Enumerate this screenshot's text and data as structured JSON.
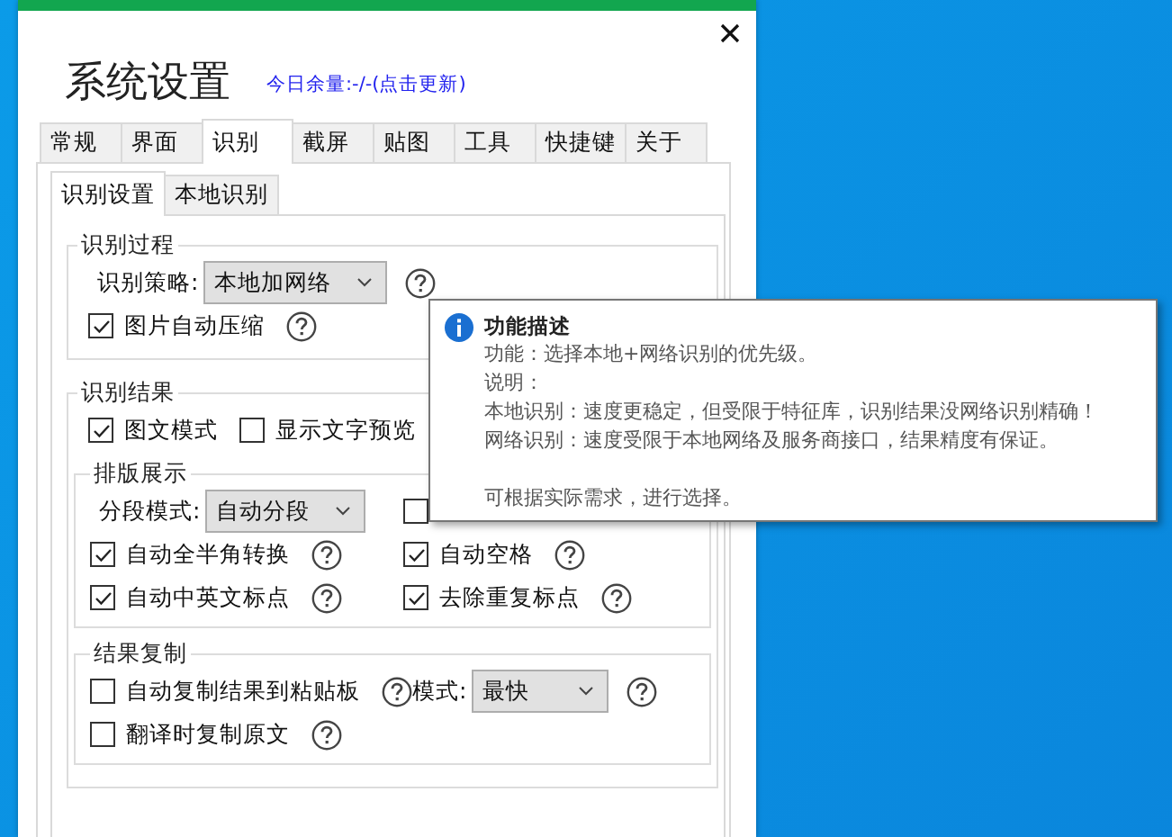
{
  "window": {
    "title": "系统设置",
    "quota_link": "今日余量:-/-(点击更新)"
  },
  "tabs": [
    {
      "label": "常规",
      "selected": false
    },
    {
      "label": "界面",
      "selected": false
    },
    {
      "label": "识别",
      "selected": true
    },
    {
      "label": "截屏",
      "selected": false
    },
    {
      "label": "贴图",
      "selected": false
    },
    {
      "label": "工具",
      "selected": false
    },
    {
      "label": "快捷键",
      "selected": false
    },
    {
      "label": "关于",
      "selected": false
    }
  ],
  "subtabs": [
    {
      "label": "识别设置",
      "selected": true
    },
    {
      "label": "本地识别",
      "selected": false
    }
  ],
  "groups": [
    {
      "title": "识别过程",
      "rows": [
        {
          "columns": [
            [
              {
                "kind": "select",
                "label": "识别策略:",
                "value": "本地加网络"
              },
              {
                "kind": "help"
              }
            ]
          ]
        },
        {
          "columns": [
            [
              {
                "kind": "checkbox",
                "label": "图片自动压缩",
                "checked": true
              },
              {
                "kind": "help"
              }
            ]
          ]
        }
      ]
    },
    {
      "title": "识别结果",
      "rows": [
        {
          "columns": [
            [
              {
                "kind": "checkbox",
                "label": "图文模式",
                "checked": true
              },
              {
                "kind": "checkbox",
                "label": "显示文字预览",
                "checked": false
              }
            ]
          ]
        }
      ],
      "children": [
        {
          "title": "排版展示",
          "rows": [
            {
              "columns": [
                [
                  {
                    "kind": "select",
                    "label": "分段模式:",
                    "value": "自动分段"
                  }
                ],
                [
                  {
                    "kind": "checkbox",
                    "checked": false
                  }
                ]
              ]
            },
            {
              "columns": [
                [
                  {
                    "kind": "checkbox",
                    "label": "自动全半角转换",
                    "checked": true
                  },
                  {
                    "kind": "help"
                  }
                ],
                [
                  {
                    "kind": "checkbox",
                    "label": "自动空格",
                    "checked": true
                  },
                  {
                    "kind": "help"
                  }
                ]
              ]
            },
            {
              "columns": [
                [
                  {
                    "kind": "checkbox",
                    "label": "自动中英文标点",
                    "checked": true
                  },
                  {
                    "kind": "help"
                  }
                ],
                [
                  {
                    "kind": "checkbox",
                    "label": "去除重复标点",
                    "checked": true
                  },
                  {
                    "kind": "help"
                  }
                ]
              ]
            }
          ]
        },
        {
          "title": "结果复制",
          "rows": [
            {
              "columns": [
                [
                  {
                    "kind": "checkbox",
                    "label": "自动复制结果到粘贴板",
                    "checked": false
                  },
                  {
                    "kind": "help"
                  }
                ],
                [
                  {
                    "kind": "select",
                    "label": "模式:",
                    "value": "最快"
                  },
                  {
                    "kind": "help"
                  }
                ]
              ]
            },
            {
              "columns": [
                [
                  {
                    "kind": "checkbox",
                    "label": "翻译时复制原文",
                    "checked": false
                  },
                  {
                    "kind": "help"
                  }
                ]
              ]
            }
          ]
        }
      ]
    }
  ],
  "tooltip": {
    "title": "功能描述",
    "lines": [
      "功能：选择本地+网络识别的优先级。",
      "说明：",
      "本地识别：速度更稳定，但受限于特征库，识别结果没网络识别精确！",
      "网络识别：速度受限于本地网络及服务商接口，结果精度有保证。"
    ],
    "note": "可根据实际需求，进行选择。"
  }
}
